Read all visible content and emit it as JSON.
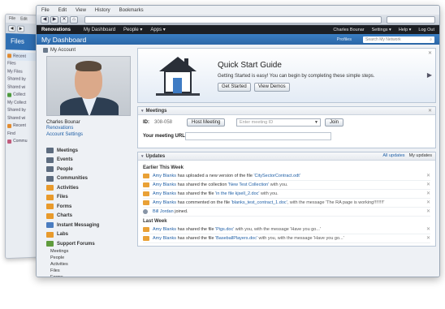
{
  "back_window": {
    "menu": [
      "File",
      "Edit"
    ],
    "header_title": "Files",
    "items": [
      {
        "label": "Recent",
        "highlight": true
      },
      {
        "label": "Files",
        "highlight": false
      },
      {
        "label": "My Files",
        "highlight": false
      },
      {
        "label": "Shared by",
        "highlight": false
      },
      {
        "label": "Shared wi",
        "highlight": false
      },
      {
        "label": "Collect",
        "highlight": false
      },
      {
        "label": "My Collect",
        "highlight": false
      },
      {
        "label": "Shared by",
        "highlight": false
      },
      {
        "label": "Shared wi",
        "highlight": false
      },
      {
        "label": "Recent",
        "highlight": false
      },
      {
        "label": "Find",
        "highlight": false
      },
      {
        "label": "Commu",
        "highlight": false
      }
    ]
  },
  "menubar": [
    "File",
    "Edit",
    "View",
    "History",
    "Bookmarks"
  ],
  "toolbar": {
    "back": "◀",
    "forward": "▶",
    "close": "✕",
    "home": "⌂"
  },
  "navbar": {
    "brand": "Renovations",
    "items": [
      "My Dashboard",
      "People ▾",
      "Apps ▾"
    ],
    "right": [
      "Charles Bounar",
      "Settings ▾",
      "Help ▾",
      "Log Out"
    ]
  },
  "banner": {
    "title": "My Dashboard",
    "profiles": "Profiles",
    "search_placeholder": "Search My Network",
    "search_icon": "search-icon"
  },
  "account": {
    "heading": "My Account",
    "name": "Charles Bounar",
    "links": [
      "Renovations",
      "Account Settings"
    ]
  },
  "apps": [
    {
      "label": "Meetings",
      "color": "#5d6c7f"
    },
    {
      "label": "Events",
      "color": "#5d6c7f"
    },
    {
      "label": "People",
      "color": "#5d6c7f"
    },
    {
      "label": "Communities",
      "color": "#5d6c7f"
    },
    {
      "label": "Activities",
      "color": "#e89a2c"
    },
    {
      "label": "Files",
      "color": "#e89a2c"
    },
    {
      "label": "Forms",
      "color": "#e89a2c"
    },
    {
      "label": "Charts",
      "color": "#e89a2c"
    },
    {
      "label": "Instant Messaging",
      "color": "#4a7cc0"
    },
    {
      "label": "Labs",
      "color": "#e89a2c"
    },
    {
      "label": "Support Forums",
      "color": "#5f9b3c"
    }
  ],
  "sub_apps": [
    "Meetings",
    "People",
    "Activities",
    "Files",
    "Forms"
  ],
  "quickstart": {
    "title": "Quick Start Guide",
    "description": "Getting Started is easy! You can begin by completing these simple steps.",
    "start_button": "Get Started",
    "demos_button": "View Demos",
    "close": "✕",
    "next": "▶"
  },
  "meetings": {
    "title": "Meetings",
    "id_label": "ID:",
    "id_value": "308-058",
    "host_button": "Host Meeting",
    "meeting_placeholder": "Enter meeting ID",
    "join_button": "Join",
    "url_label": "Your meeting URL:",
    "close": "✕"
  },
  "updates": {
    "title": "Updates",
    "tabs": [
      "All updates",
      "My updates"
    ],
    "close": "✕",
    "sections": [
      {
        "heading": "Earlier This Week",
        "rows": [
          {
            "actor": "Amy Blanks",
            "text": " has uploaded a new version of the file ",
            "link": "'CitySectorContract.odt'",
            "tail": "",
            "icon": "file"
          },
          {
            "actor": "Amy Blanks",
            "text": " has shared the collection ",
            "link": "'New Test Collection'",
            "tail": " with you.",
            "icon": "file"
          },
          {
            "actor": "Amy Blanks",
            "text": " has shared the file ",
            "link": "'in the file kjsell_2.doc'",
            "tail": " with you.",
            "icon": "file"
          },
          {
            "actor": "Amy Blanks",
            "text": " has commented on the file ",
            "link": "'blanks_test_contract_1.doc'",
            "tail": ", with the message 'The RA page is working!!!!!!!!'",
            "icon": "file"
          },
          {
            "actor": "Bill Jordan",
            "text": " joined.",
            "link": "",
            "tail": "",
            "icon": "person"
          }
        ]
      },
      {
        "heading": "Last Week",
        "rows": [
          {
            "actor": "Amy Blanks",
            "text": " has shared the file ",
            "link": "'Pigs.doc'",
            "tail": " with you, with the message 'Have you go...'",
            "icon": "file"
          },
          {
            "actor": "Amy Blanks",
            "text": " has shared the file ",
            "link": "'BaseballPlayers.doc'",
            "tail": " with you, with the message 'Have you go...'",
            "icon": "file"
          }
        ]
      }
    ]
  }
}
